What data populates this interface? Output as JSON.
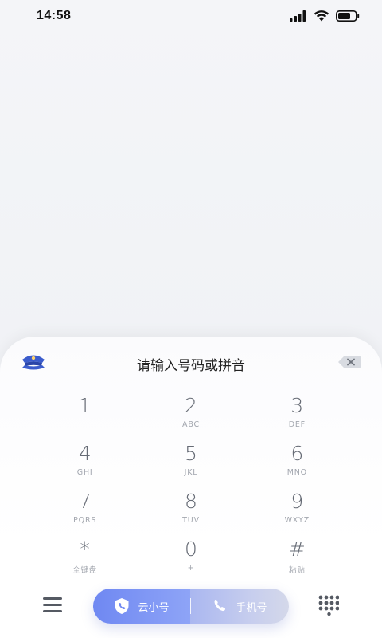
{
  "status_bar": {
    "time": "14:58",
    "icons": [
      "signal-icon",
      "wifi-icon",
      "battery-icon"
    ]
  },
  "dialer": {
    "placeholder": "请输入号码或拼音",
    "badge_icon": "police-cap-icon",
    "backspace_icon": "backspace-icon",
    "keys": [
      {
        "digit": "1",
        "letters": ""
      },
      {
        "digit": "2",
        "letters": "ABC"
      },
      {
        "digit": "3",
        "letters": "DEF"
      },
      {
        "digit": "4",
        "letters": "GHI"
      },
      {
        "digit": "5",
        "letters": "JKL"
      },
      {
        "digit": "6",
        "letters": "MNO"
      },
      {
        "digit": "7",
        "letters": "PQRS"
      },
      {
        "digit": "8",
        "letters": "TUV"
      },
      {
        "digit": "9",
        "letters": "WXYZ"
      },
      {
        "digit": "*",
        "letters": "全键盘"
      },
      {
        "digit": "0",
        "letters": "+"
      },
      {
        "digit": "#",
        "letters": "粘贴"
      }
    ]
  },
  "bottom_bar": {
    "menu_icon": "hamburger-menu-icon",
    "cloud_call_label": "云小号",
    "cloud_call_icon": "shield-phone-icon",
    "mobile_call_label": "手机号",
    "mobile_call_icon": "phone-icon",
    "keypad_toggle_icon": "keypad-dots-icon"
  },
  "colors": {
    "accent": "#7189f2",
    "digit": "#666b75",
    "letters": "#a2a6ae"
  }
}
